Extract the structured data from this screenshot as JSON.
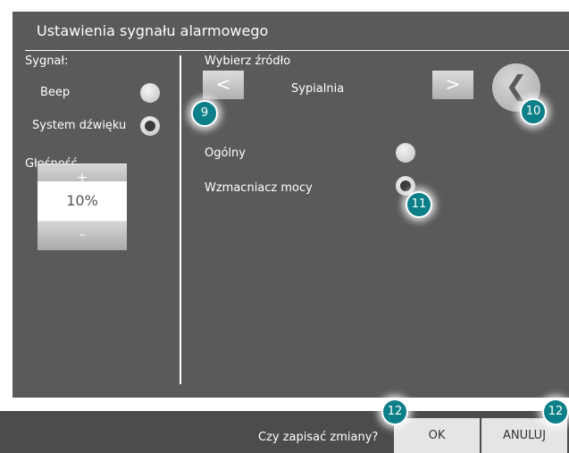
{
  "title": "Ustawienia sygnału alarmowego",
  "left": {
    "signal_label": "Sygnał:",
    "options": [
      {
        "label": "Beep",
        "selected": false
      },
      {
        "label": "System dźwięku",
        "selected": true
      }
    ],
    "volume_label": "Głośność",
    "volume_plus": "+",
    "volume_value": "10%",
    "volume_minus": "–"
  },
  "right": {
    "source_label": "Wybierz źródło",
    "prev": "<",
    "source_value": "Sypialnia",
    "next": ">",
    "back": "❮",
    "options": [
      {
        "label": "Ogólny",
        "selected": false
      },
      {
        "label": "Wzmacniacz mocy",
        "selected": true
      }
    ]
  },
  "badges": {
    "b9": "9",
    "b10": "10",
    "b11": "11",
    "b12a": "12",
    "b12b": "12"
  },
  "footer": {
    "question": "Czy zapisać zmiany?",
    "ok": "OK",
    "cancel": "ANULUJ"
  },
  "colors": {
    "panel": "#5a5a5a",
    "badge": "#0d7f88",
    "footer": "#4c4c4c"
  }
}
